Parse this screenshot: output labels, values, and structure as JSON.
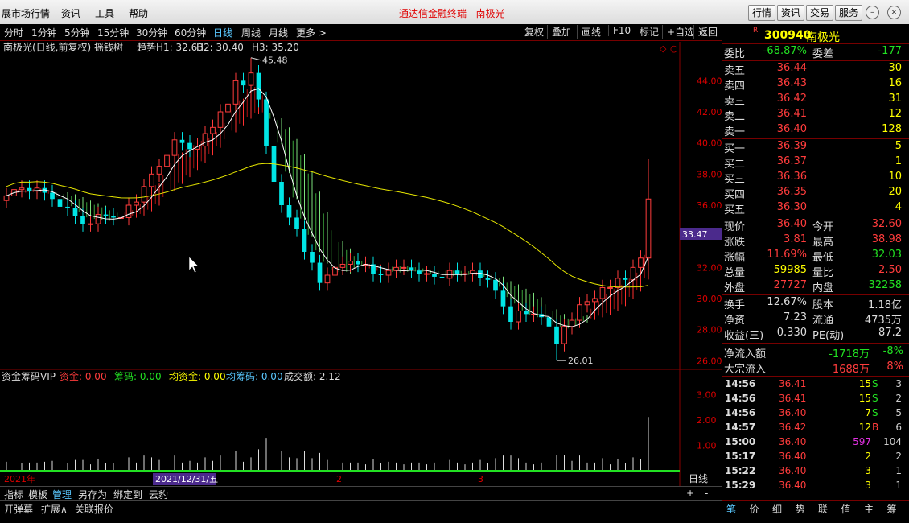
{
  "titlebar": {
    "menus": [
      "展市场行情",
      "资讯",
      "工具",
      "帮助"
    ],
    "center_title": "通达信金融终端",
    "center_stock": "南极光",
    "buttons": [
      "行情",
      "资讯",
      "交易",
      "服务"
    ]
  },
  "periods": [
    "分时",
    "1分钟",
    "5分钟",
    "15分钟",
    "30分钟",
    "60分钟",
    "日线",
    "周线",
    "月线",
    "更多 >"
  ],
  "active_period": "日线",
  "right_tools": [
    "复权",
    "叠加",
    "画线",
    "F10",
    "标记",
    "+自选",
    "返回"
  ],
  "main_chart": {
    "legend_name": "南极光(日线,前复权) 摇钱树",
    "h1": "趋势H1: 32.63",
    "h2": "H2: 30.40",
    "h3": "H3: 35.20",
    "high_label": "45.48",
    "low_label": "26.01",
    "current_price_tag": "33.47",
    "y_ticks": [
      "44.00",
      "42.00",
      "40.00",
      "38.00",
      "36.00",
      "34.00",
      "32.00",
      "30.00",
      "28.00",
      "26.00"
    ]
  },
  "sub_chart": {
    "name": "资金筹码VIP",
    "fund": "资金: 0.00",
    "chip": "筹码: 0.00",
    "avg_fund": "均资金: 0.00",
    "avg_chip": "均筹码: 0.00",
    "turnover": "成交额: 2.12",
    "y_ticks": [
      "3.00",
      "2.00",
      "1.00"
    ],
    "period_label": "日线"
  },
  "x_axis": {
    "year": "2021年",
    "date_cursor": "2021/12/31/五",
    "month2": "2",
    "month3": "3"
  },
  "bottom_tabs": [
    "指标",
    "模板",
    "管理",
    "另存为",
    "绑定到",
    "云豹"
  ],
  "bottom_tabs2": [
    "开弹幕",
    "扩展∧",
    "关联报价"
  ],
  "quote": {
    "code": "300940",
    "name": "南极光",
    "weibi_label": "委比",
    "weibi": "-68.87%",
    "weicha_label": "委差",
    "weicha": "-177",
    "asks": [
      {
        "label": "卖五",
        "price": "36.44",
        "vol": "30"
      },
      {
        "label": "卖四",
        "price": "36.43",
        "vol": "16"
      },
      {
        "label": "卖三",
        "price": "36.42",
        "vol": "31"
      },
      {
        "label": "卖二",
        "price": "36.41",
        "vol": "12"
      },
      {
        "label": "卖一",
        "price": "36.40",
        "vol": "128"
      }
    ],
    "bids": [
      {
        "label": "买一",
        "price": "36.39",
        "vol": "5"
      },
      {
        "label": "买二",
        "price": "36.37",
        "vol": "1"
      },
      {
        "label": "买三",
        "price": "36.36",
        "vol": "10"
      },
      {
        "label": "买四",
        "price": "36.35",
        "vol": "20"
      },
      {
        "label": "买五",
        "price": "36.30",
        "vol": "4"
      }
    ],
    "stats": [
      {
        "l1": "现价",
        "v1": "36.40",
        "c1": "red",
        "l2": "今开",
        "v2": "32.60",
        "c2": "red"
      },
      {
        "l1": "涨跌",
        "v1": "3.81",
        "c1": "red",
        "l2": "最高",
        "v2": "38.98",
        "c2": "red"
      },
      {
        "l1": "涨幅",
        "v1": "11.69%",
        "c1": "red",
        "l2": "最低",
        "v2": "32.03",
        "c2": "grn"
      },
      {
        "l1": "总量",
        "v1": "59985",
        "c1": "yel",
        "l2": "量比",
        "v2": "2.50",
        "c2": "red"
      },
      {
        "l1": "外盘",
        "v1": "27727",
        "c1": "red",
        "l2": "内盘",
        "v2": "32258",
        "c2": "grn"
      }
    ],
    "stats2": [
      {
        "l1": "换手",
        "v1": "12.67%",
        "c1": "wht",
        "l2": "股本",
        "v2": "1.18亿",
        "c2": "wht"
      },
      {
        "l1": "净资",
        "v1": "7.23",
        "c1": "wht",
        "l2": "流通",
        "v2": "4735万",
        "c2": "wht"
      },
      {
        "l1": "收益(三)",
        "v1": "0.330",
        "c1": "wht",
        "l2": "PE(动)",
        "v2": "87.2",
        "c2": "wht"
      }
    ],
    "flow": [
      {
        "label": "净流入额",
        "value": "-1718万",
        "pct": "-8%",
        "color": "grn"
      },
      {
        "label": "大宗流入",
        "value": "1688万",
        "pct": "8%",
        "color": "red"
      }
    ],
    "ticks": [
      {
        "time": "14:56",
        "price": "36.41",
        "vol": "15",
        "side": "S",
        "n": "3"
      },
      {
        "time": "14:56",
        "price": "36.41",
        "vol": "15",
        "side": "S",
        "n": "2"
      },
      {
        "time": "14:56",
        "price": "36.40",
        "vol": "7",
        "side": "S",
        "n": "5"
      },
      {
        "time": "14:57",
        "price": "36.42",
        "vol": "12",
        "side": "B",
        "n": "6"
      },
      {
        "time": "15:00",
        "price": "36.40",
        "vol": "597",
        "side": "",
        "n": "104"
      },
      {
        "time": "15:17",
        "price": "36.40",
        "vol": "2",
        "side": "",
        "n": "2"
      },
      {
        "time": "15:22",
        "price": "36.40",
        "vol": "3",
        "side": "",
        "n": "1"
      },
      {
        "time": "15:29",
        "price": "36.40",
        "vol": "3",
        "side": "",
        "n": "1"
      }
    ],
    "right_tabs": [
      "笔",
      "价",
      "细",
      "势",
      "联",
      "值",
      "主",
      "筹"
    ]
  },
  "chart_data": {
    "type": "candlestick",
    "x": [
      "2021-12-10",
      "2021-12-13",
      "2021-12-14",
      "2021-12-15",
      "2021-12-16",
      "2021-12-17",
      "2021-12-20",
      "2021-12-21",
      "2021-12-22",
      "2021-12-23",
      "2021-12-24",
      "2021-12-27",
      "2021-12-28",
      "2021-12-29",
      "2021-12-30",
      "2021-12-31",
      "2022-01-04",
      "2022-01-05",
      "2022-01-06",
      "2022-01-07",
      "2022-01-10",
      "2022-01-11",
      "2022-01-12",
      "2022-01-13",
      "2022-01-14",
      "2022-01-17",
      "2022-01-18",
      "2022-01-19",
      "2022-01-20",
      "2022-01-21",
      "2022-01-24",
      "2022-01-25",
      "2022-01-26",
      "2022-01-27",
      "2022-01-28",
      "2022-02-07",
      "2022-02-08",
      "2022-02-09",
      "2022-02-10",
      "2022-02-11",
      "2022-02-14",
      "2022-02-15",
      "2022-02-16",
      "2022-02-17",
      "2022-02-18",
      "2022-02-21",
      "2022-02-22",
      "2022-02-23",
      "2022-02-24",
      "2022-02-25",
      "2022-02-28",
      "2022-03-01",
      "2022-03-02",
      "2022-03-03",
      "2022-03-04",
      "2022-03-07",
      "2022-03-08",
      "2022-03-09",
      "2022-03-10",
      "2022-03-11",
      "2022-03-14",
      "2022-03-15",
      "2022-03-16",
      "2022-03-17",
      "2022-03-18",
      "2022-03-21",
      "2022-03-22",
      "2022-03-23",
      "2022-03-24",
      "2022-03-25",
      "2022-03-28",
      "2022-03-29",
      "2022-03-30",
      "2022-03-31",
      "2022-04-01",
      "2022-04-06",
      "2022-04-07",
      "2022-04-08",
      "2022-04-11",
      "2022-04-12",
      "2022-04-13"
    ],
    "open": [
      36.3,
      36.6,
      37.0,
      37.1,
      36.9,
      37.1,
      36.8,
      36.4,
      35.9,
      35.8,
      35.3,
      34.8,
      34.8,
      35.4,
      35.3,
      35.2,
      35.2,
      36.0,
      36.2,
      37.2,
      38.0,
      38.5,
      39.2,
      40.2,
      40.0,
      39.6,
      39.8,
      40.6,
      41.0,
      42.0,
      42.5,
      44.0,
      43.7,
      44.5,
      42.8,
      39.8,
      37.5,
      36.0,
      35.2,
      34.5,
      33.0,
      32.3,
      31.0,
      31.5,
      32.0,
      32.2,
      32.4,
      32.2,
      32.2,
      31.6,
      31.5,
      31.8,
      32.0,
      32.0,
      31.8,
      31.6,
      31.6,
      31.4,
      31.3,
      31.8,
      31.6,
      31.6,
      31.8,
      31.3,
      31.2,
      30.5,
      29.5,
      28.5,
      29.2,
      29.0,
      29.0,
      28.8,
      28.2,
      27.1,
      28.2,
      28.6,
      29.6,
      29.8,
      30.0,
      30.7,
      30.7,
      31.3,
      31.2,
      32.0,
      32.6
    ],
    "close": [
      36.6,
      37.0,
      37.1,
      36.9,
      37.1,
      36.8,
      36.4,
      35.9,
      35.8,
      35.3,
      34.8,
      34.8,
      35.4,
      35.3,
      35.2,
      35.2,
      36.0,
      36.2,
      37.2,
      38.0,
      38.5,
      39.2,
      40.2,
      40.0,
      39.6,
      39.8,
      40.6,
      41.0,
      42.0,
      42.5,
      44.0,
      43.7,
      44.5,
      42.8,
      39.8,
      37.5,
      36.0,
      35.2,
      34.5,
      33.0,
      32.3,
      31.0,
      31.5,
      32.0,
      32.2,
      32.4,
      32.2,
      32.2,
      31.6,
      31.5,
      31.8,
      32.0,
      32.0,
      31.8,
      31.6,
      31.6,
      31.4,
      31.3,
      31.8,
      31.6,
      31.6,
      31.8,
      31.3,
      31.2,
      30.5,
      29.5,
      28.5,
      29.2,
      29.0,
      29.0,
      28.8,
      28.2,
      27.1,
      28.2,
      28.6,
      29.6,
      29.8,
      30.0,
      30.7,
      30.7,
      31.3,
      31.2,
      32.0,
      32.6,
      36.4
    ],
    "high": 45.48,
    "low": 26.01,
    "last_high": 38.98,
    "ylim": [
      25.5,
      46.5
    ],
    "volume_ylim": [
      0,
      3.4
    ],
    "last_volume": 2.12
  }
}
